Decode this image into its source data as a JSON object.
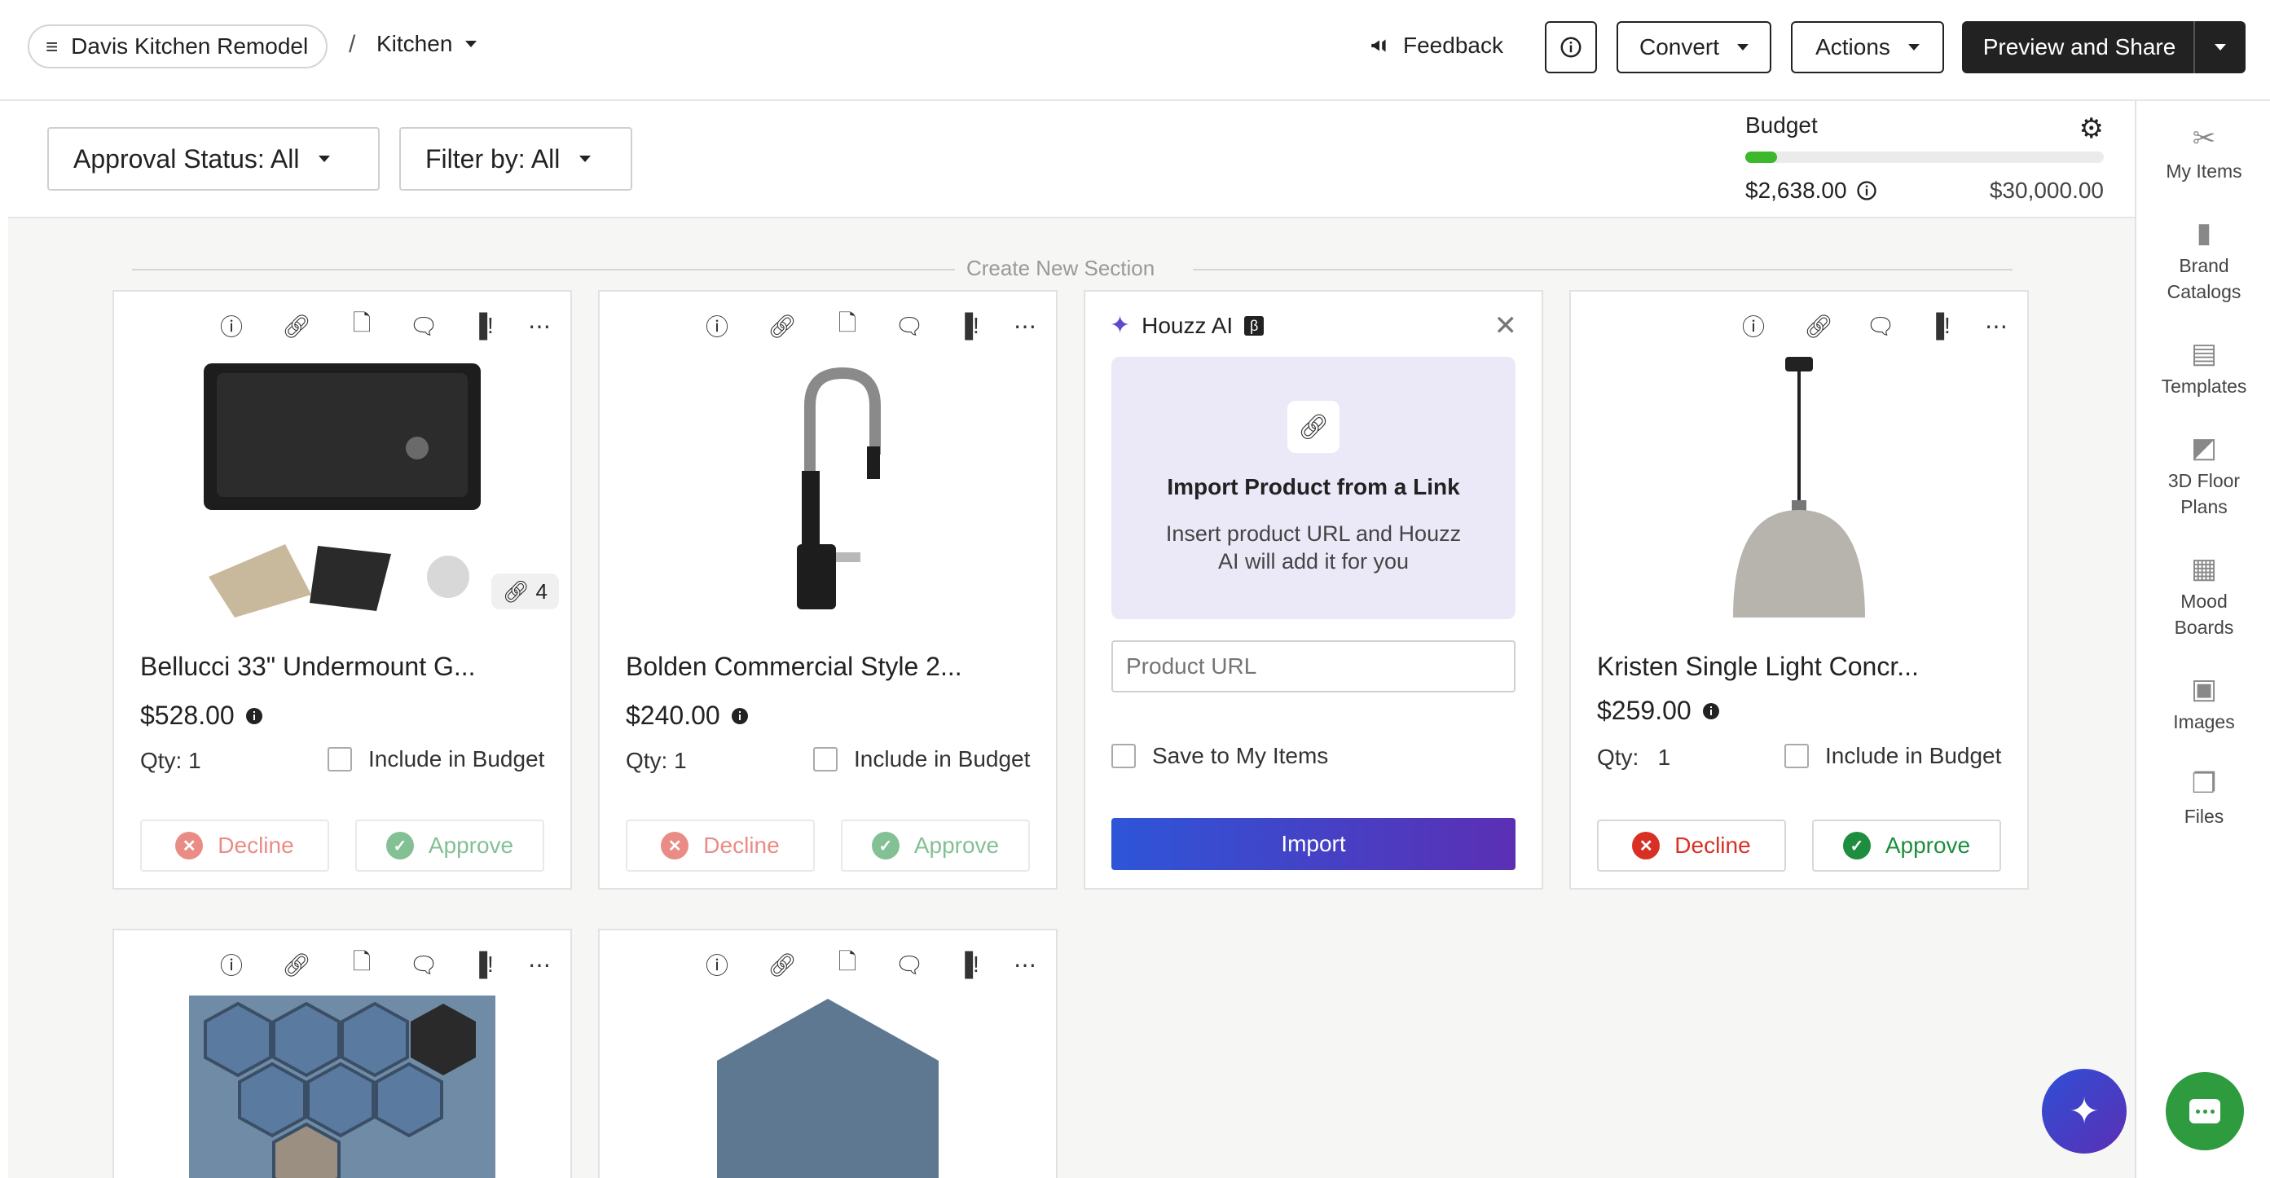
{
  "header": {
    "project_name": "Davis Kitchen Remodel",
    "breadcrumb_sep": "/",
    "room": "Kitchen",
    "feedback": "Feedback",
    "convert": "Convert",
    "actions": "Actions",
    "preview_share": "Preview and Share"
  },
  "toolbar": {
    "approval_filter": "Approval Status: All",
    "filter_by": "Filter by: All"
  },
  "budget": {
    "title": "Budget",
    "spent": "$2,638.00",
    "total": "$30,000.00",
    "progress_fraction": 0.088,
    "bar_color": "#3bb82b"
  },
  "section": {
    "create_label": "Create New Section"
  },
  "cards": [
    {
      "title": "Bellucci 33\" Undermount G...",
      "price": "$528.00",
      "qty": "Qty: 1",
      "include_budget": "Include in Budget",
      "decline": "Decline",
      "approve": "Approve",
      "link_count": "4"
    },
    {
      "title": "Bolden Commercial Style 2...",
      "price": "$240.00",
      "qty": "Qty: 1",
      "include_budget": "Include in Budget",
      "decline": "Decline",
      "approve": "Approve"
    },
    {
      "title": "Kristen Single Light Concr...",
      "price": "$259.00",
      "qty": "Qty:   1",
      "include_budget": "Include in Budget",
      "decline": "Decline",
      "approve": "Approve"
    }
  ],
  "ai_card": {
    "title": "Houzz AI",
    "beta": "β",
    "box_title": "Import Product from a Link",
    "box_desc": "Insert product URL and Houzz AI will add it for you",
    "url_placeholder": "Product URL",
    "save_label": "Save to My Items",
    "import": "Import"
  },
  "rail": {
    "items": [
      "My Items",
      "Brand Catalogs",
      "Templates",
      "3D Floor Plans",
      "Mood Boards",
      "Images",
      "Files"
    ]
  },
  "colors": {
    "decline": "#d93025",
    "approve": "#1e8e3e",
    "ai_gradient_start": "#2e55d8",
    "ai_gradient_end": "#5b2fb4",
    "chat": "#2d9b3e"
  }
}
